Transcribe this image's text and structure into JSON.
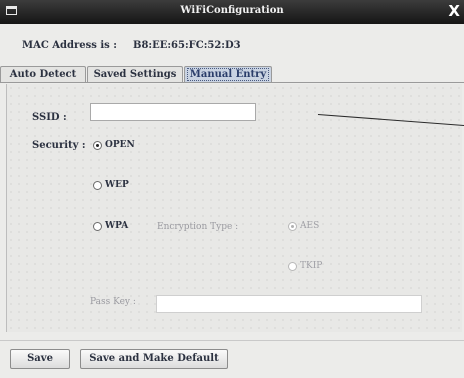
{
  "window": {
    "title": "WiFiConfiguration",
    "close_glyph": "X",
    "menu_icon": "window-menu-icon"
  },
  "mac": {
    "label": "MAC Address is :",
    "value": "B8:EE:65:FC:52:D3"
  },
  "tabs": [
    {
      "label": "Auto Detect",
      "active": false
    },
    {
      "label": "Saved Settings",
      "active": false
    },
    {
      "label": "Manual Entry",
      "active": true
    }
  ],
  "form": {
    "ssid_label": "SSID :",
    "ssid_value": "",
    "security_label": "Security :",
    "security_options": [
      {
        "label": "OPEN",
        "selected": true
      },
      {
        "label": "WEP",
        "selected": false
      },
      {
        "label": "WPA",
        "selected": false
      }
    ],
    "encryption_label": "Encryption Type :",
    "encryption_options": [
      {
        "label": "AES",
        "selected": true
      },
      {
        "label": "TKIP",
        "selected": false
      }
    ],
    "passkey_label": "Pass Key :",
    "passkey_value": ""
  },
  "buttons": {
    "save": "Save",
    "save_default": "Save and Make Default"
  },
  "colors": {
    "titlebar": "#1e1e1e",
    "active_tab": "#c9d3e2",
    "panel": "#e8e8e6"
  }
}
